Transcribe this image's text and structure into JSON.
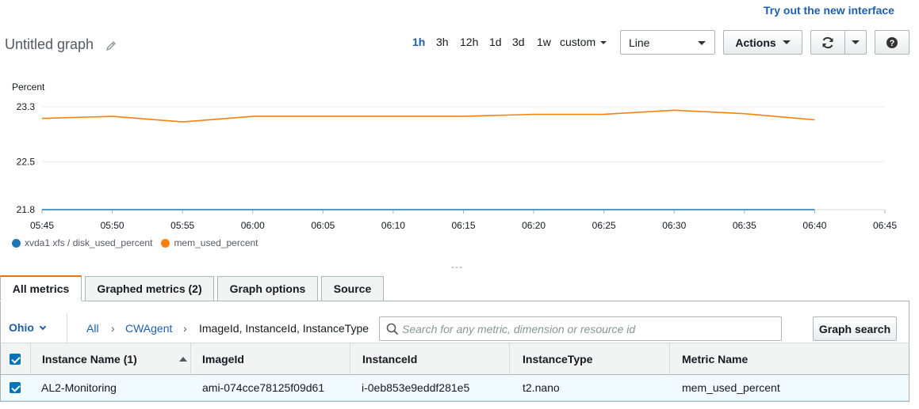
{
  "header": {
    "try_new_interface": "Try out the new interface",
    "graph_title": "Untitled graph"
  },
  "time_ranges": [
    "1h",
    "3h",
    "12h",
    "1d",
    "3d",
    "1w"
  ],
  "active_range": "1h",
  "custom_label": "custom",
  "chart_type_select": "Line",
  "actions_label": "Actions",
  "colors": {
    "link": "#1f5ea8",
    "series_disk": "#1f77b4",
    "series_mem": "#ff7f0e",
    "tab_accent": "#ec7211"
  },
  "chart_data": {
    "type": "line",
    "ylabel": "Percent",
    "ylim": [
      21.8,
      23.3
    ],
    "yticks": [
      "23.3",
      "22.5",
      "21.8"
    ],
    "xticks": [
      "05:45",
      "05:50",
      "05:55",
      "06:00",
      "06:05",
      "06:10",
      "06:15",
      "06:20",
      "06:25",
      "06:30",
      "06:35",
      "06:40",
      "06:45"
    ],
    "x": [
      "05:45",
      "05:50",
      "05:55",
      "06:00",
      "06:05",
      "06:10",
      "06:15",
      "06:20",
      "06:25",
      "06:30",
      "06:35",
      "06:40"
    ],
    "series": [
      {
        "name": "xvda1 xfs / disk_used_percent",
        "color": "#1f77b4",
        "values": [
          21.8,
          21.8,
          21.8,
          21.8,
          21.8,
          21.8,
          21.8,
          21.8,
          21.8,
          21.8,
          21.8,
          21.8
        ]
      },
      {
        "name": "mem_used_percent",
        "color": "#ff7f0e",
        "values": [
          23.13,
          23.16,
          23.08,
          23.16,
          23.16,
          23.16,
          23.16,
          23.19,
          23.19,
          23.25,
          23.2,
          23.11
        ]
      }
    ]
  },
  "drag_handle": "---",
  "tabs": [
    {
      "label": "All metrics",
      "active": true
    },
    {
      "label": "Graphed metrics (2)",
      "active": false
    },
    {
      "label": "Graph options",
      "active": false
    },
    {
      "label": "Source",
      "active": false
    }
  ],
  "browser": {
    "region": "Ohio",
    "breadcrumbs": [
      "All",
      "CWAgent",
      "ImageId, InstanceId, InstanceType"
    ],
    "search_placeholder": "Search for any metric, dimension or resource id",
    "graph_search_label": "Graph search"
  },
  "table": {
    "columns": [
      "Instance Name (1)",
      "ImageId",
      "InstanceId",
      "InstanceType",
      "Metric Name"
    ],
    "rows": [
      [
        "AL2-Monitoring",
        "ami-074cce78125f09d61",
        "i-0eb853e9eddf281e5",
        "t2.nano",
        "mem_used_percent"
      ]
    ]
  }
}
